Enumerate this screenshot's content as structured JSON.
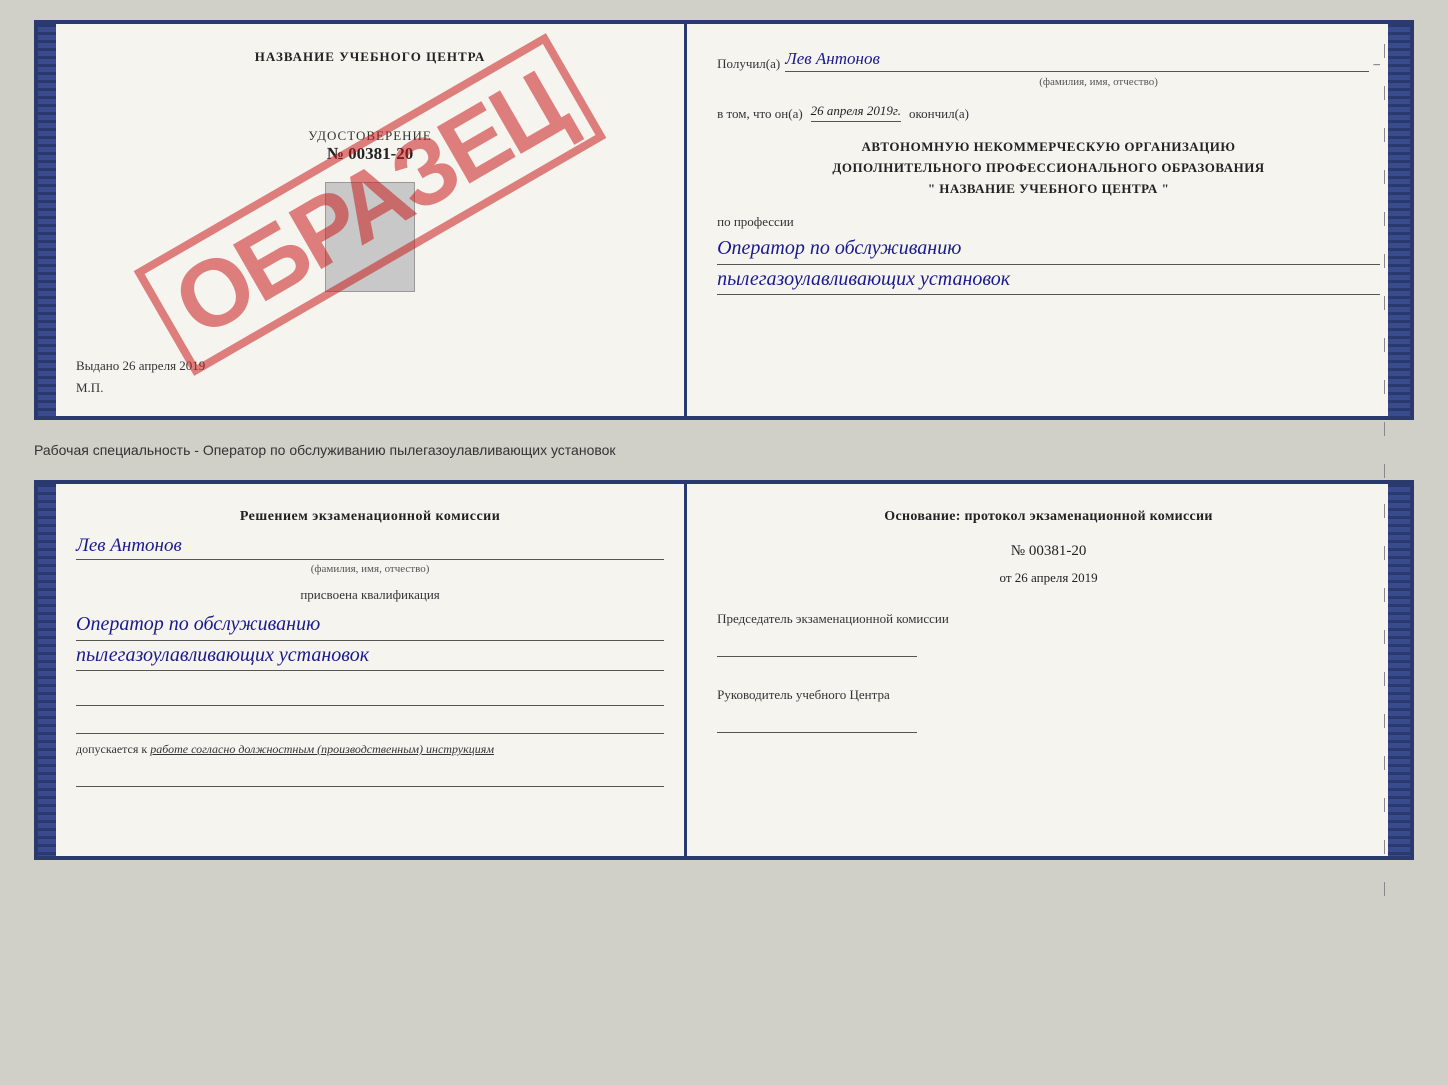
{
  "page": {
    "specialty_label": "Рабочая специальность - Оператор по обслуживанию пылегазоулавливающих установок"
  },
  "certificate": {
    "school_title": "НАЗВАНИЕ УЧЕБНОГО ЦЕНТРА",
    "stamp_text": "ОБРАЗЕЦ",
    "id_label": "УДОСТОВЕРЕНИЕ",
    "id_number": "№ 00381-20",
    "issued_label": "Выдано",
    "issued_date": "26 апреля 2019",
    "mp_label": "М.П.",
    "recipient_label": "Получил(а)",
    "recipient_name": "Лев Антонов",
    "recipient_subtitle": "(фамилия, имя, отчество)",
    "recipient_dash": "–",
    "date_prefix": "в том, что он(а)",
    "date_value": "26 апреля 2019г.",
    "date_suffix": "окончил(а)",
    "org_line1": "АВТОНОМНУЮ НЕКОММЕРЧЕСКУЮ ОРГАНИЗАЦИЮ",
    "org_line2": "ДОПОЛНИТЕЛЬНОГО ПРОФЕССИОНАЛЬНОГО ОБРАЗОВАНИЯ",
    "org_line3": "\"   НАЗВАНИЕ УЧЕБНОГО ЦЕНТРА   \"",
    "profession_label": "по профессии",
    "profession_line1": "Оператор по обслуживанию",
    "profession_line2": "пылегазоулавливающих установок"
  },
  "diploma": {
    "decision_title": "Решением экзаменационной комиссии",
    "decision_name": "Лев Антонов",
    "fio_subtitle": "(фамилия, имя, отчество)",
    "qualification_text": "присвоена квалификация",
    "qual_line1": "Оператор по обслуживанию",
    "qual_line2": "пылегазоулавливающих установок",
    "допускается_text": "допускается к",
    "допускается_detail": "работе согласно должностным (производственным) инструкциям",
    "osnov_title": "Основание: протокол экзаменационной комиссии",
    "protocol_number": "№ 00381-20",
    "protocol_date_prefix": "от",
    "protocol_date": "26 апреля 2019",
    "chairman_label": "Председатель экзаменационной комиссии",
    "head_label": "Руководитель учебного Центра"
  }
}
